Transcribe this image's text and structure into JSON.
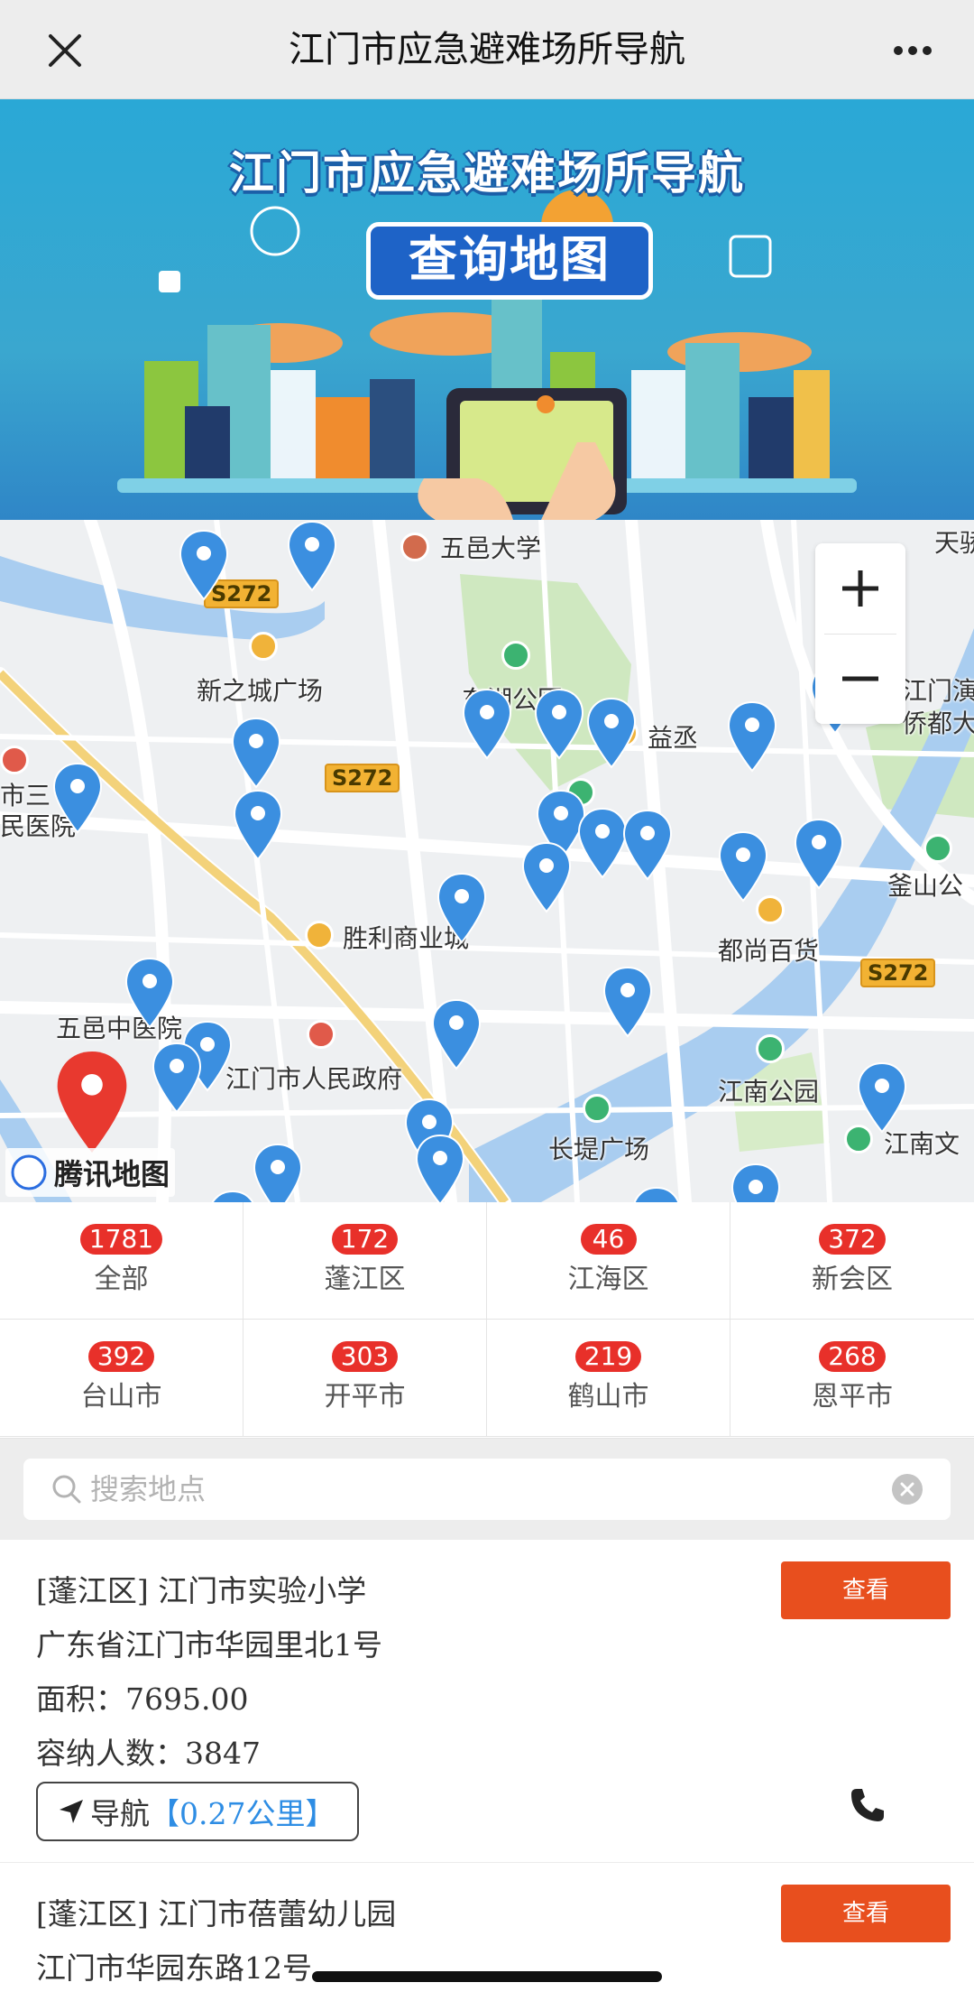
{
  "navbar": {
    "title": "江门市应急避难场所导航",
    "close_icon": "close-icon",
    "more_icon": "more-horizontal-icon"
  },
  "banner": {
    "title": "江门市应急避难场所导航",
    "subtitle": "查询地图"
  },
  "map": {
    "labels": {
      "wuyi_uni": "五邑大学",
      "tian": "天骄",
      "xinzhicheng": "新之城广场",
      "donghu": "东湖公园",
      "yicheng": "益丞",
      "jiangmen_qiao": "江门演",
      "qiaodu": "侨都大",
      "shi_hospital_l1": "市三",
      "shi_hospital_l2": "民医院",
      "fushan": "釜山公",
      "shengli": "胜利商业城",
      "dushang": "都尚百货",
      "wuyi_hospital": "五邑中医院",
      "gov": "江门市人民政府",
      "jiangnan_park": "江南公园",
      "changdi": "长堤广场",
      "jiangnan_wen": "江南文",
      "road_1": "S272",
      "road_2": "S272",
      "road_3": "S272"
    },
    "provider": "腾讯地图",
    "zoom_in_icon": "plus-icon",
    "zoom_out_icon": "minus-icon"
  },
  "districts": [
    {
      "count": "1781",
      "name": "全部"
    },
    {
      "count": "172",
      "name": "蓬江区"
    },
    {
      "count": "46",
      "name": "江海区"
    },
    {
      "count": "372",
      "name": "新会区"
    },
    {
      "count": "392",
      "name": "台山市"
    },
    {
      "count": "303",
      "name": "开平市"
    },
    {
      "count": "219",
      "name": "鹤山市"
    },
    {
      "count": "268",
      "name": "恩平市"
    }
  ],
  "search": {
    "placeholder": "搜索地点",
    "value": ""
  },
  "results": [
    {
      "title": "[蓬江区] 江门市实验小学",
      "address": "广东省江门市华园里北1号",
      "area": "面积：7695.00",
      "capacity": "容纳人数：3847",
      "view_label": "查看",
      "nav_label": "导航",
      "distance": "【0.27公里】"
    },
    {
      "title": "[蓬江区] 江门市蓓蕾幼儿园",
      "address": "江门市华园东路12号",
      "view_label": "查看"
    }
  ],
  "colors": {
    "accent_red": "#e8302a",
    "view_button": "#e84f1e",
    "pin_blue": "#3b8fe0",
    "link_blue": "#2e8de4"
  }
}
